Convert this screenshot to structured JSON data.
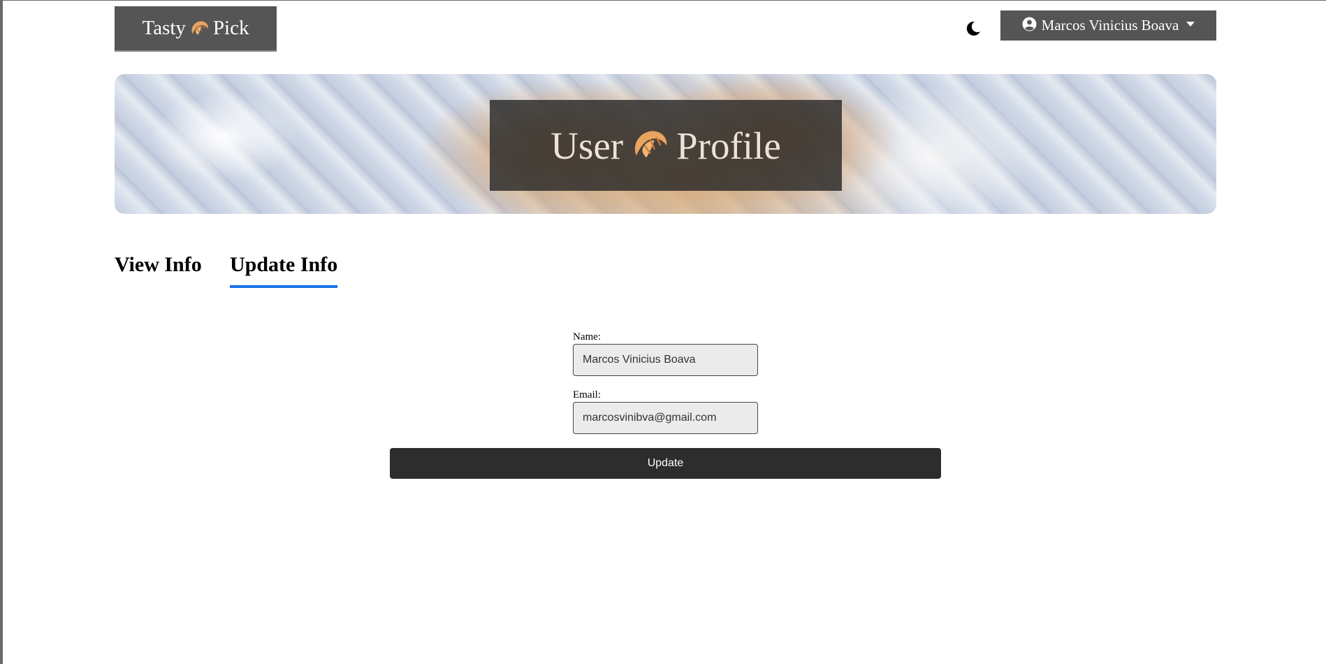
{
  "header": {
    "brand_left": "Tasty",
    "brand_right": "Pick",
    "user_name": "Marcos Vinicius Boava",
    "icons": {
      "brand": "croissant-icon",
      "theme": "moon-icon",
      "user": "user-circle-icon",
      "dropdown": "caret-down-icon"
    }
  },
  "hero": {
    "title_left": "User",
    "title_right": "Profile"
  },
  "tabs": [
    {
      "label": "View Info",
      "active": false
    },
    {
      "label": "Update Info",
      "active": true
    }
  ],
  "form": {
    "name_label": "Name:",
    "name_value": "Marcos Vinicius Boava",
    "email_label": "Email:",
    "email_value": "marcosvinibva@gmail.com",
    "submit_label": "Update"
  },
  "colors": {
    "header_bg": "#555555",
    "active_tab_underline": "#1a73e8",
    "button_bg": "#2d2d2d",
    "croissant": "#e9a45f"
  }
}
